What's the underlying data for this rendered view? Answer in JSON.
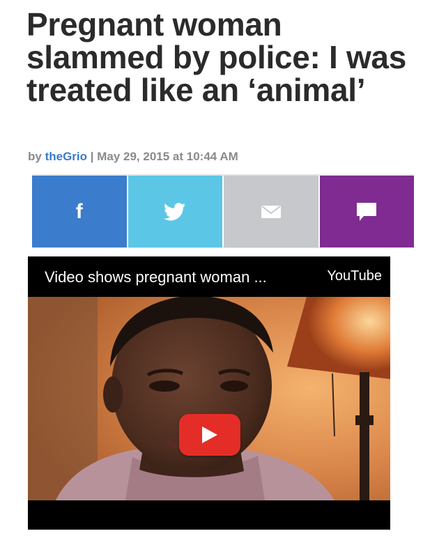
{
  "article": {
    "headline": "Pregnant woman slammed by police: I was treated like an ‘animal’",
    "byline_prefix": "by ",
    "author": "theGrio",
    "separator": " | ",
    "date": "May 29, 2015 at 10:44 AM"
  },
  "share_bar": {
    "buttons": [
      {
        "name": "facebook",
        "icon": "facebook-icon",
        "color": "#3b7ccc"
      },
      {
        "name": "twitter",
        "icon": "twitter-bird-icon",
        "color": "#5bc6e6"
      },
      {
        "name": "email",
        "icon": "envelope-icon",
        "color": "#c7c8cb"
      },
      {
        "name": "comments",
        "icon": "comment-bubble-icon",
        "color": "#7f2b91"
      }
    ],
    "facebook_glyph": "f"
  },
  "video": {
    "title": "Video shows pregnant woman ...",
    "provider": "YouTube",
    "play_icon": "play-icon",
    "play_color": "#e52d27"
  }
}
